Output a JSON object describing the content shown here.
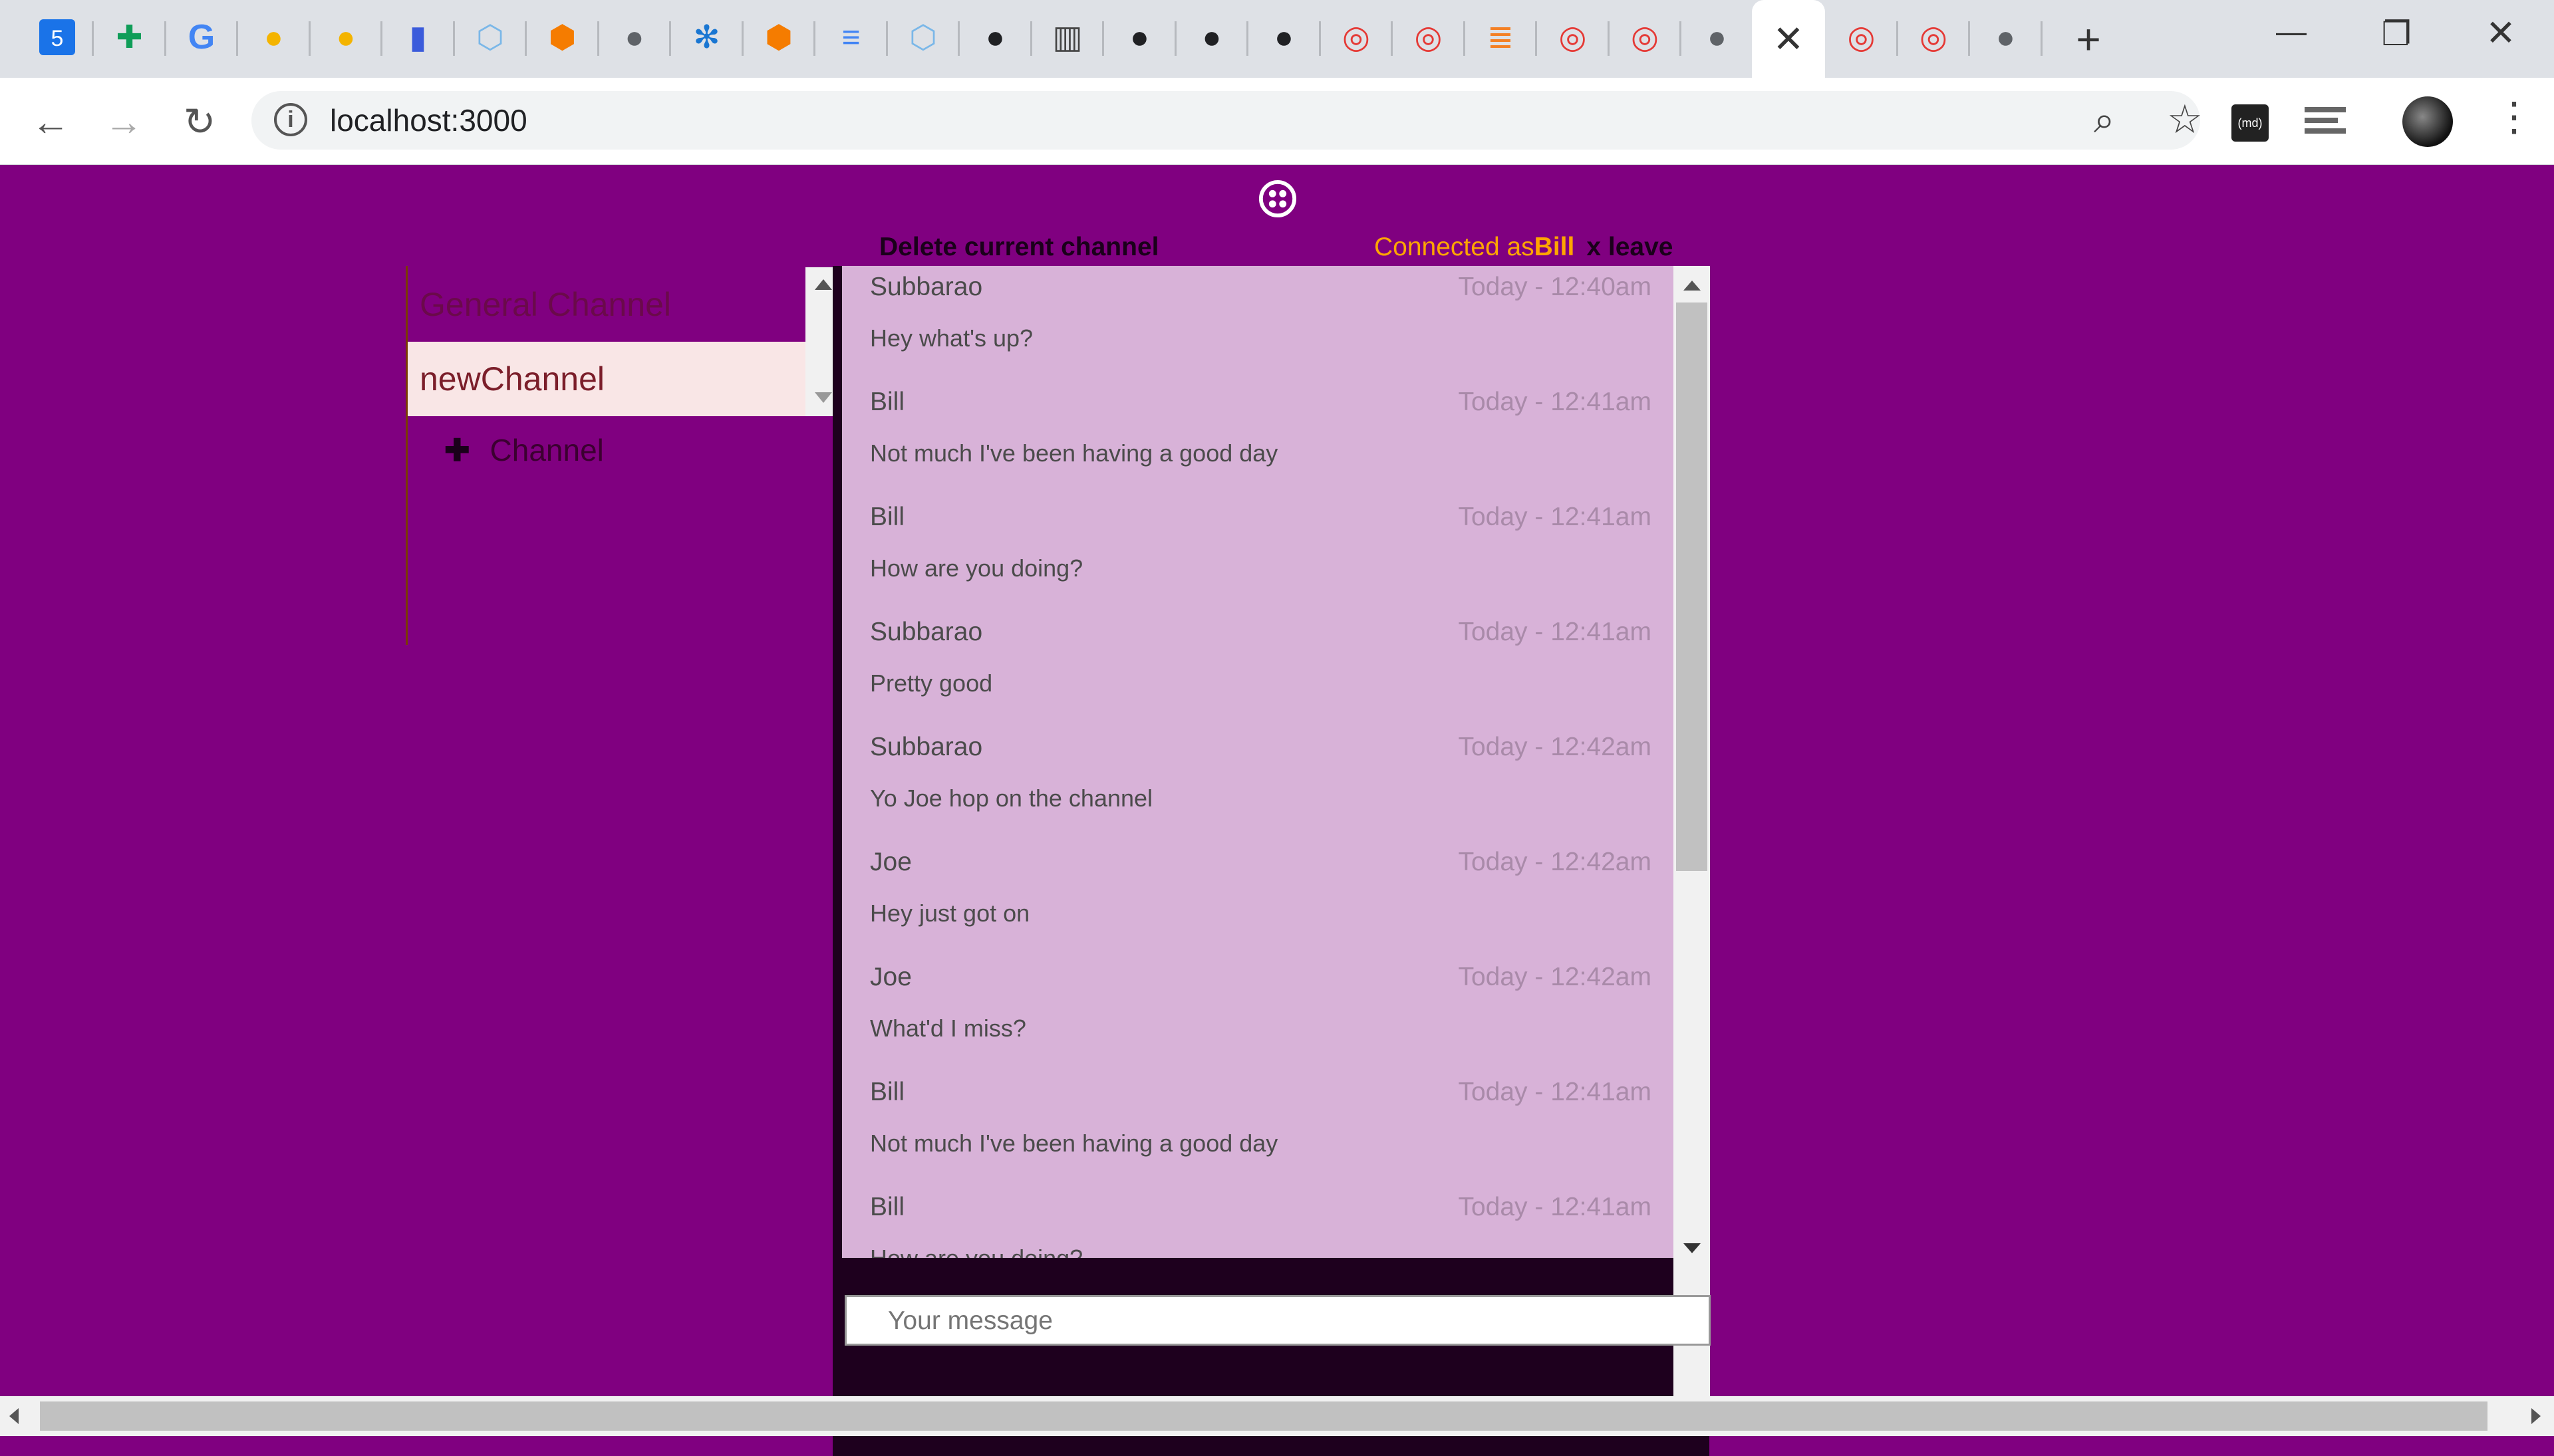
{
  "browser": {
    "tab_icons": [
      "calendar-icon",
      "sheets-icon",
      "google-icon",
      "bee-icon",
      "bee-icon",
      "book-icon",
      "cube-icon",
      "package-icon",
      "globe-icon",
      "snowflake-icon",
      "package-icon",
      "docs-icon",
      "cube-icon",
      "github-icon",
      "chart-icon",
      "github-icon",
      "github-icon",
      "github-icon",
      "twilio-icon",
      "twilio-icon",
      "stackoverflow-icon",
      "twilio-icon",
      "twilio-icon",
      "globe-icon",
      "close-icon",
      "twilio-icon",
      "twilio-icon",
      "globe-icon"
    ],
    "calendar_day": "5",
    "url": "localhost:3000",
    "extension_label": "(md)"
  },
  "app": {
    "delete_label": "Delete current channel",
    "connected_prefix": "Connected as",
    "username": "Bill",
    "leave_label": "x leave"
  },
  "channels": [
    {
      "label": "General Channel",
      "active": false
    },
    {
      "label": "newChannel",
      "active": true
    }
  ],
  "add_channel_label": "Channel",
  "messages": [
    {
      "author": "Subbarao",
      "time": "Today - 12:40am",
      "body": "Hey what's up?"
    },
    {
      "author": "Bill",
      "time": "Today - 12:41am",
      "body": "Not much I've been having a good day"
    },
    {
      "author": "Bill",
      "time": "Today - 12:41am",
      "body": "How are you doing?"
    },
    {
      "author": "Subbarao",
      "time": "Today - 12:41am",
      "body": "Pretty good"
    },
    {
      "author": "Subbarao",
      "time": "Today - 12:42am",
      "body": "Yo Joe hop on the channel"
    },
    {
      "author": "Joe",
      "time": "Today - 12:42am",
      "body": "Hey just got on"
    },
    {
      "author": "Joe",
      "time": "Today - 12:42am",
      "body": "What'd I miss?"
    },
    {
      "author": "Bill",
      "time": "Today - 12:41am",
      "body": "Not much I've been having a good day"
    },
    {
      "author": "Bill",
      "time": "Today - 12:41am",
      "body": "How are you doing?"
    }
  ],
  "composer": {
    "placeholder": "Your message"
  },
  "colors": {
    "page_bg": "#800080",
    "chat_bg": "#d8b2d8",
    "connected": "#ffa500"
  }
}
